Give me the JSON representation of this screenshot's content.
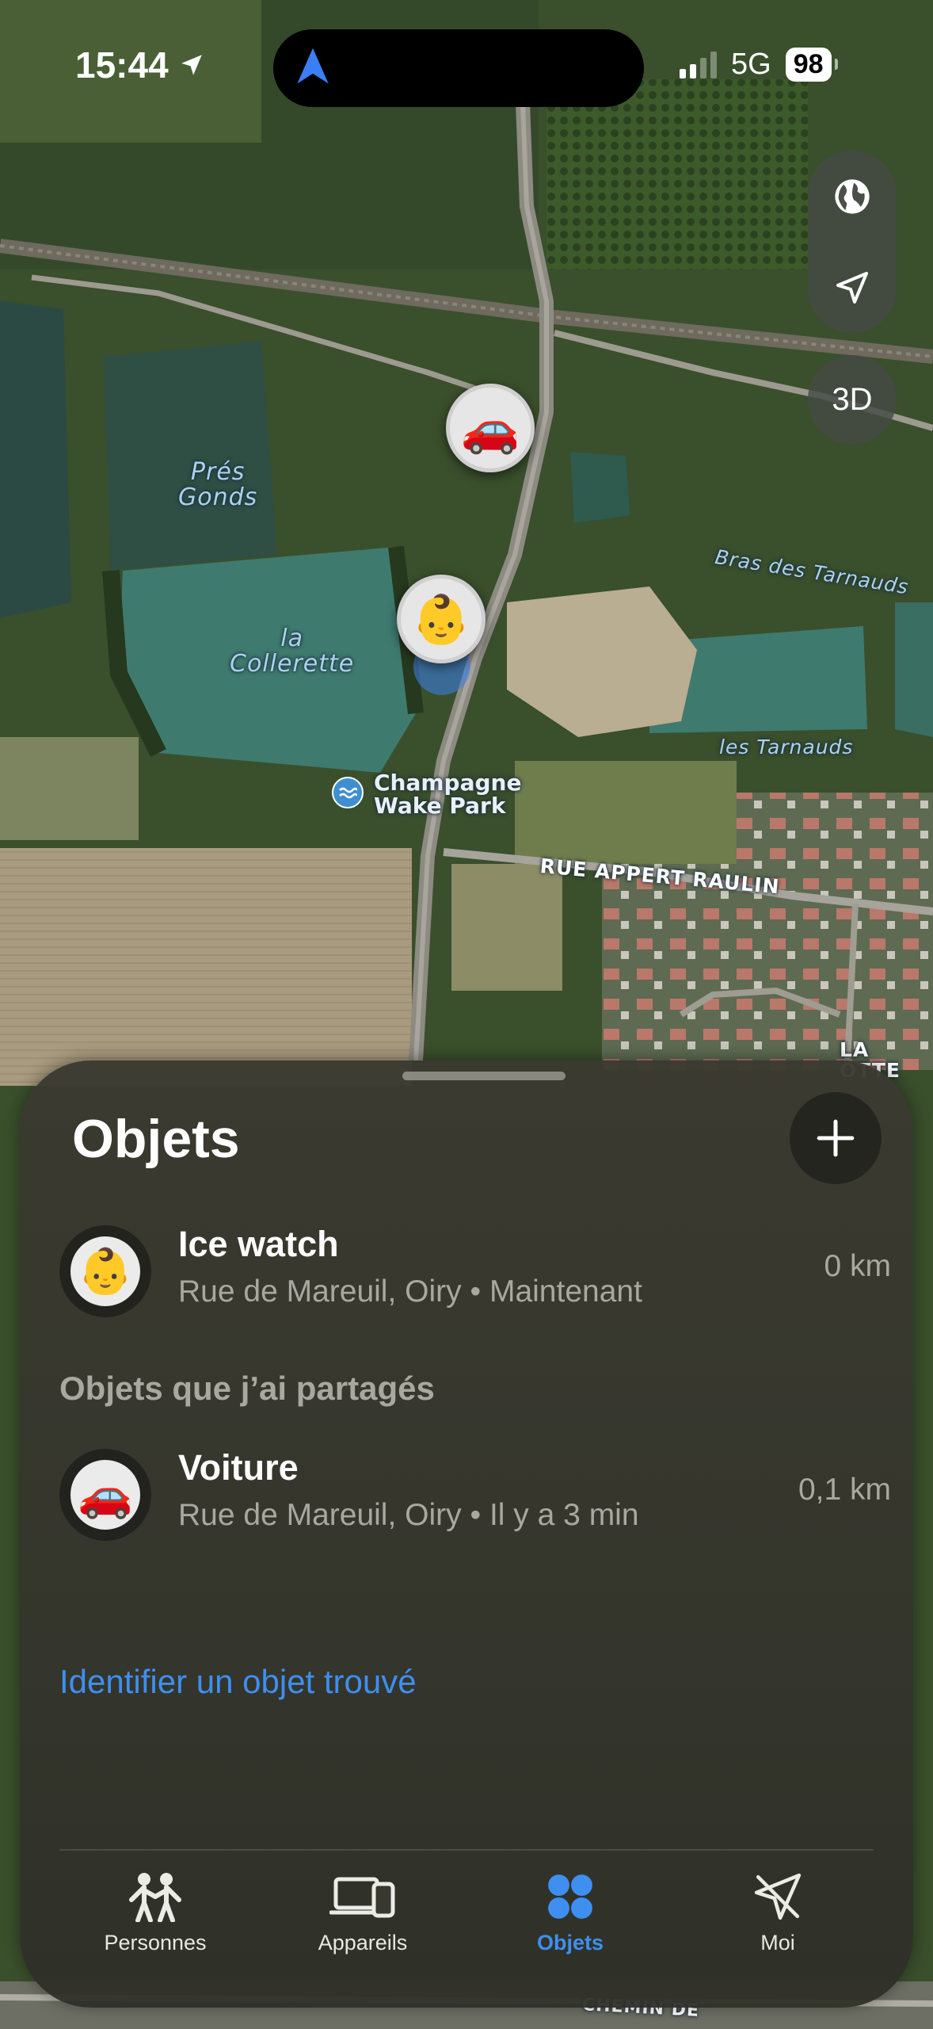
{
  "status_bar": {
    "time": "15:44",
    "network": "5G",
    "battery": "98",
    "signal_bars_filled": 2,
    "signal_bars_total": 4
  },
  "map": {
    "labels": {
      "pres_gonds": "Prés\nGonds",
      "la_collerette": "la\nCollerette",
      "bras_des_tarnauds": "Bras des Tarnauds",
      "les_tarnauds": "les Tarnauds",
      "champagne_wake_park": "Champagne\nWake Park",
      "rue_appert_raulin": "RUE APPERT RAULIN",
      "la_rotte_partial": "LA\nOTTE",
      "chemin_partial": "CHEMIN DE"
    },
    "controls": {
      "globe_icon": "globe-icon",
      "location_icon": "location-arrow-icon",
      "three_d_label": "3D"
    },
    "pins": [
      {
        "name": "Voiture",
        "emoji": "🚗"
      },
      {
        "name": "Ice watch",
        "emoji": "👶"
      }
    ]
  },
  "sheet": {
    "title": "Objets",
    "add_button_icon": "plus-icon",
    "items": [
      {
        "name": "Ice watch",
        "emoji": "👶",
        "location": "Rue de Mareuil, Oiry",
        "time": "Maintenant",
        "distance": "0 km"
      }
    ],
    "shared_section_title": "Objets que j’ai partagés",
    "shared_items": [
      {
        "name": "Voiture",
        "emoji": "🚗",
        "location": "Rue de Mareuil, Oiry",
        "time": "Il y a 3 min",
        "distance": "0,1 km"
      }
    ],
    "identify_link": "Identifier un objet trouvé"
  },
  "tabbar": {
    "tabs": [
      {
        "label": "Personnes",
        "icon": "people-icon",
        "active": false
      },
      {
        "label": "Appareils",
        "icon": "devices-icon",
        "active": false
      },
      {
        "label": "Objets",
        "icon": "items-icon",
        "active": true
      },
      {
        "label": "Moi",
        "icon": "me-icon",
        "active": false
      }
    ]
  },
  "colors": {
    "accent_blue": "#3e8ff0",
    "sheet_bg": "#3a3930",
    "secondary_text": "#a9a8a0"
  }
}
